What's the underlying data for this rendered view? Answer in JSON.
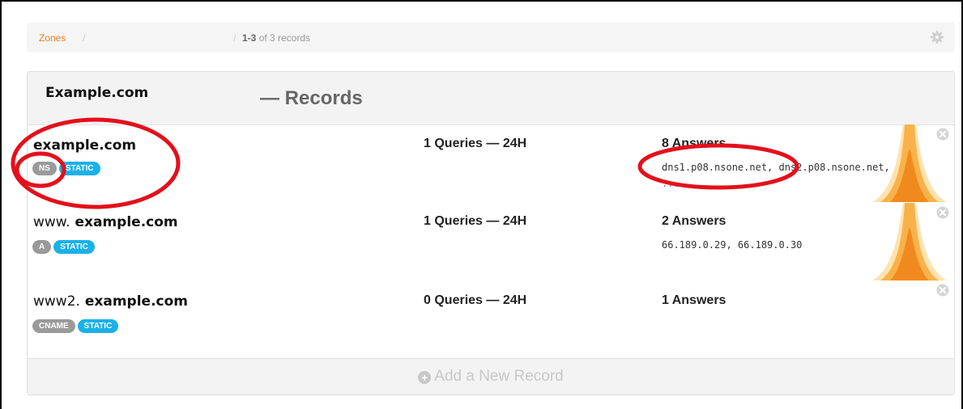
{
  "breadcrumb": {
    "zones_label": "Zones",
    "separator": "/",
    "count_range": "1-3",
    "count_suffix": "of 3 records"
  },
  "header": {
    "zone": "Example.com",
    "records_title": "— Records"
  },
  "records": [
    {
      "name_prefix": "",
      "name_main": "example.com",
      "type": "NS",
      "static": "STATIC",
      "queries": "1 Queries — 24H",
      "answers": "8 Answers",
      "values": "dns1.p08.nsone.net, dns2.p08.nsone.net,",
      "more": "..."
    },
    {
      "name_prefix": "www.",
      "name_main": "example.com",
      "type": "A",
      "static": "STATIC",
      "queries": "1 Queries — 24H",
      "answers": "2 Answers",
      "values": "66.189.0.29, 66.189.0.30",
      "more": ""
    },
    {
      "name_prefix": "www2.",
      "name_main": "example.com",
      "type": "CNAME",
      "static": "STATIC",
      "queries": "0 Queries — 24H",
      "answers": "1 Answers",
      "values": "",
      "more": ""
    }
  ],
  "add_record": "Add a New Record",
  "colors": {
    "accent_orange": "#e8821e",
    "badge_type": "#9a9a9a",
    "badge_static": "#19b1ea",
    "annotation": "#e3101b"
  }
}
